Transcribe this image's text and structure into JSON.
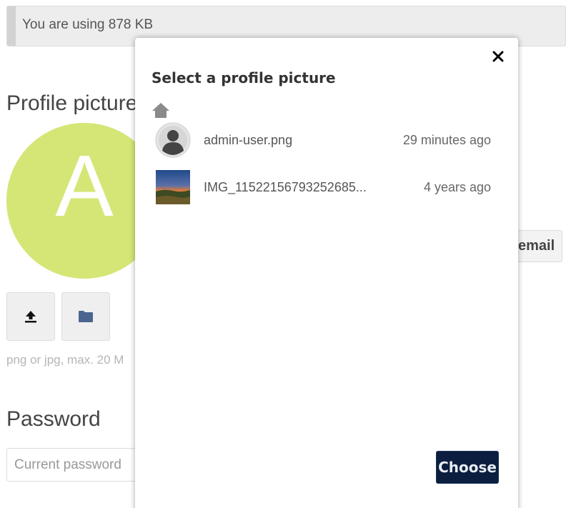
{
  "usage": {
    "text": "You are using 878 KB"
  },
  "profile": {
    "title": "Profile picture",
    "avatar_letter": "A",
    "avatar_color": "#d5e676",
    "hint": "png or jpg, max. 20 M",
    "upload_icon": "upload-icon",
    "folder_icon": "folder-icon"
  },
  "email": {
    "button_label": "email"
  },
  "password": {
    "title": "Password",
    "current_placeholder": "Current password"
  },
  "modal": {
    "title": "Select a profile picture",
    "close_icon": "close-icon",
    "breadcrumb_icon": "home-icon",
    "files": [
      {
        "name": "admin-user.png",
        "time": "29 minutes ago",
        "thumb": "user-avatar"
      },
      {
        "name": "IMG_11522156793252685...",
        "time": "4 years ago",
        "thumb": "landscape-photo"
      }
    ],
    "choose_label": "Choose",
    "choose_color": "#0b1e3f"
  }
}
